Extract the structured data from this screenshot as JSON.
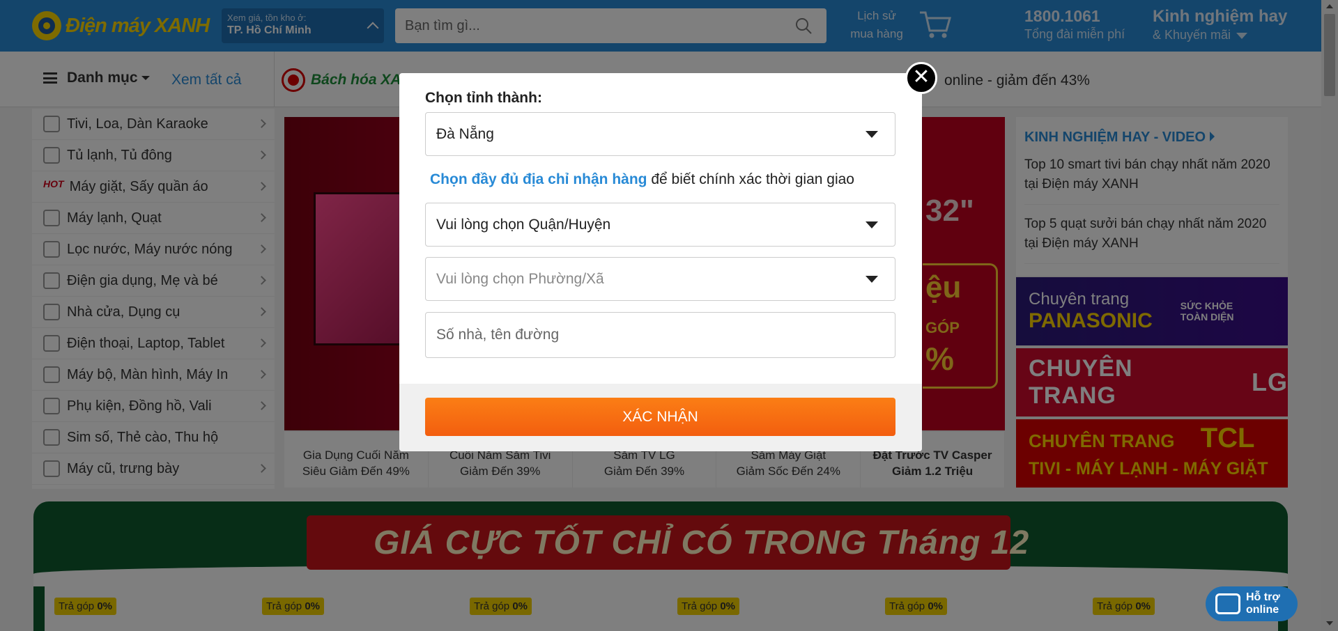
{
  "header": {
    "logo_text": "Điện máy XANH",
    "location_label": "Xem giá, tồn kho ở:",
    "location_city": "TP. Hồ Chí Minh",
    "search_placeholder": "Bạn tìm gì...",
    "history_line1": "Lịch sử",
    "history_line2": "mua hàng",
    "hotline_number": "1800.1061",
    "hotline_label": "Tổng đài miễn phí",
    "tips_line1": "Kinh nghiệm hay",
    "tips_line2": "& Khuyến mãi"
  },
  "subbar": {
    "category_label": "Danh mục",
    "see_all": "Xem tất cả",
    "bhx_label": "Bách hóa XANH",
    "promo_text": "online - giảm đến 43%"
  },
  "menu": [
    {
      "label": "Tivi, Loa, Dàn Karaoke",
      "icon": "tv-icon",
      "hot": ""
    },
    {
      "label": "Tủ lạnh, Tủ đông",
      "icon": "fridge-icon",
      "hot": ""
    },
    {
      "label": "Máy giặt, Sấy quần áo",
      "icon": "washer-icon",
      "hot": "HOT"
    },
    {
      "label": "Máy lạnh, Quạt",
      "icon": "aircon-icon",
      "hot": ""
    },
    {
      "label": "Lọc nước, Máy nước nóng",
      "icon": "water-filter-icon",
      "hot": ""
    },
    {
      "label": "Điện gia dụng, Mẹ và bé",
      "icon": "appliance-icon",
      "hot": ""
    },
    {
      "label": "Nhà cửa, Dụng cụ",
      "icon": "house-icon",
      "hot": ""
    },
    {
      "label": "Điện thoại, Laptop, Tablet",
      "icon": "phone-icon",
      "hot": ""
    },
    {
      "label": "Máy bộ, Màn hình, Máy In",
      "icon": "monitor-icon",
      "hot": ""
    },
    {
      "label": "Phụ kiện, Đồng hồ, Vali",
      "icon": "headphones-icon",
      "hot": ""
    },
    {
      "label": "Sim số, Thẻ cào, Thu hộ",
      "icon": "sim-icon",
      "hot": ""
    },
    {
      "label": "Máy cũ, trưng bày",
      "icon": "recycle-icon",
      "hot": ""
    }
  ],
  "banner": {
    "partial_1": "32\"",
    "partial_2": "ệu",
    "partial_3": "GÓP",
    "partial_4": "%"
  },
  "banner_tabs": [
    {
      "line1": "Gia Dụng Cuối Năm",
      "line2": "Siêu Giảm Đến 49%"
    },
    {
      "line1": "Cuối Năm Săm Tivi",
      "line2": "Giảm Đến 39%"
    },
    {
      "line1": "Săm TV LG",
      "line2": "Giảm Đến 39%"
    },
    {
      "line1": "Săm Máy Giặt",
      "line2": "Giảm Sốc Đến 24%"
    },
    {
      "line1": "Đặt Trước TV Casper",
      "line2": "Giảm 1.2 Triệu"
    }
  ],
  "right_column": {
    "title": "KINH NGHIỆM HAY - VIDEO",
    "items": [
      "Top 10 smart tivi bán chạy nhất năm 2020 tại Điện máy XANH",
      "Top 5 quạt sưởi bán chạy nhất năm 2020 tại Điện máy XANH"
    ]
  },
  "side_banners": {
    "panasonic_top": "Chuyên trang",
    "panasonic_brand": "PANASONIC",
    "panasonic_badge": "SỨC KHỎE TOÀN DIỆN",
    "lg": "CHUYÊN TRANG",
    "lg_brand": "LG",
    "tcl_line1": "CHUYÊN TRANG",
    "tcl_brand": "TCL",
    "tcl_line2": "TIVI - MÁY LẠNH - MÁY GIẶT"
  },
  "xmas_banner": {
    "text": "GIÁ CỰC TỐT CHỈ CÓ TRONG Tháng 12"
  },
  "products": {
    "installment_prefix": "Trả góp",
    "installment_rate": "0%",
    "count": 6
  },
  "modal": {
    "label": "Chọn tỉnh thành:",
    "province_value": "Đà Nẵng",
    "hint_link": "Chọn đầy đủ địa chỉ nhận hàng",
    "hint_text": "để biết chính xác thời gian giao",
    "district_placeholder": "Vui lòng chọn Quận/Huyện",
    "ward_placeholder": "Vui lòng chọn Phường/Xã",
    "address_placeholder": "Số nhà, tên đường",
    "confirm_label": "XÁC NHẬN"
  },
  "support": {
    "line1": "Hỗ trợ",
    "line2": "online"
  },
  "colors": {
    "header_blue": "#288ad6",
    "confirm_orange": "#f35e0f",
    "link_blue": "#288ad6"
  }
}
